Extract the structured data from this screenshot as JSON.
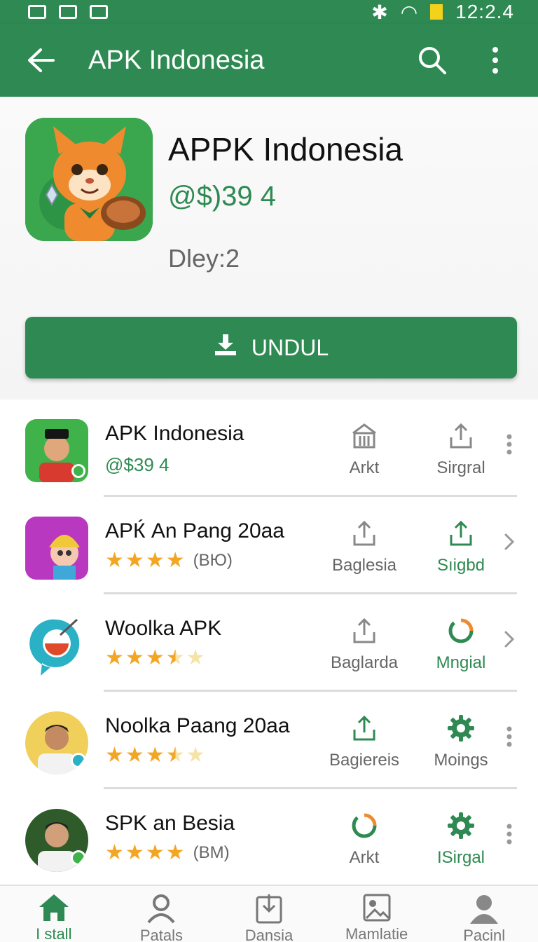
{
  "status_bar": {
    "time": "12:2.4"
  },
  "app_bar": {
    "title": "APK Indonesia",
    "back_icon": "arrow-left-icon",
    "search_icon": "search-icon",
    "menu_icon": "more-vert-icon"
  },
  "hero": {
    "app_name": "APPK Indonesia",
    "price": "@$)39 4",
    "version": "Dley:2",
    "install_label": "UNDUL",
    "install_icon": "download-icon"
  },
  "apps": [
    {
      "title": "APK Indonesia",
      "subtitle": "@$39 4",
      "rating": null,
      "rating_text": "",
      "action1": {
        "icon": "store-icon",
        "label": "Arkt"
      },
      "action2": {
        "icon": "share-icon",
        "label": "Sirgral"
      },
      "trailing": "more-vert-icon"
    },
    {
      "title": "APЌ An Pang 20aa",
      "subtitle": "",
      "rating": 4,
      "rating_text": "(BЮ)",
      "action1": {
        "icon": "share-icon",
        "label": "Baglesia"
      },
      "action2": {
        "icon": "share-icon",
        "label": "Sıigbd"
      },
      "trailing": "chevron-right-icon"
    },
    {
      "title": "Woolka APK",
      "subtitle": "",
      "rating": 3.5,
      "rating_text": "",
      "action1": {
        "icon": "share-icon",
        "label": "Baglarda"
      },
      "action2": {
        "icon": "progress-ring-icon",
        "label": "Mngial"
      },
      "trailing": "chevron-right-icon"
    },
    {
      "title": "Noolka Paang 20aa",
      "subtitle": "",
      "rating": 3.5,
      "rating_text": "",
      "action1": {
        "icon": "share-icon",
        "label": "Bagiereis"
      },
      "action2": {
        "icon": "gear-icon",
        "label": "Moings"
      },
      "trailing": "more-vert-icon"
    },
    {
      "title": "SPK an Besia",
      "subtitle": "",
      "rating": 4,
      "rating_text": "(BM)",
      "action1": {
        "icon": "progress-ring-icon",
        "label": "Arkt"
      },
      "action2": {
        "icon": "gear-icon",
        "label": "ISirgal"
      },
      "trailing": "more-vert-icon"
    }
  ],
  "bottom_nav": [
    {
      "label": "I stall",
      "icon": "home-icon",
      "active": true
    },
    {
      "label": "Patals",
      "icon": "person-icon",
      "active": false
    },
    {
      "label": "Dansia",
      "icon": "download-box-icon",
      "active": false
    },
    {
      "label": "Mamlatie",
      "icon": "image-icon",
      "active": false
    },
    {
      "label": "Pacinl",
      "icon": "profile-icon",
      "active": false
    }
  ],
  "colors": {
    "primary": "#2e8a52",
    "star": "#f2a624",
    "text_secondary": "#666666"
  }
}
